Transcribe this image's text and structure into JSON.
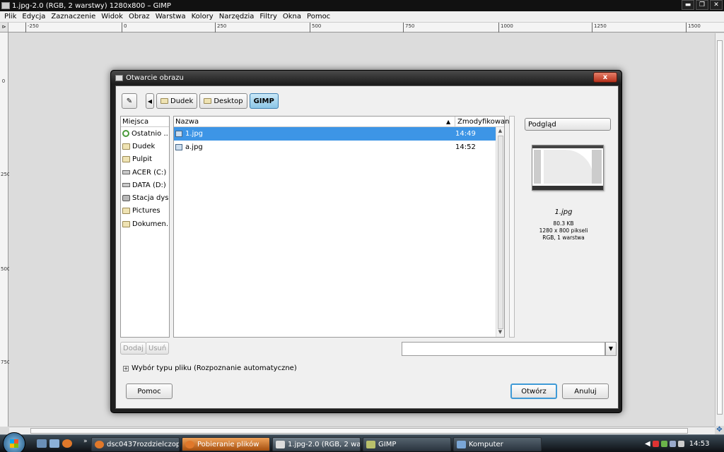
{
  "window": {
    "title": "1.jpg-2.0 (RGB, 2 warstwy) 1280x800 – GIMP",
    "controls": {
      "min": "▬",
      "max": "❐",
      "close": "✕"
    }
  },
  "menu": [
    {
      "label": "Plik"
    },
    {
      "label": "Edycja"
    },
    {
      "label": "Zaznaczenie"
    },
    {
      "label": "Widok"
    },
    {
      "label": "Obraz"
    },
    {
      "label": "Warstwa"
    },
    {
      "label": "Kolory"
    },
    {
      "label": "Narzędzia"
    },
    {
      "label": "Filtry"
    },
    {
      "label": "Okna"
    },
    {
      "label": "Pomoc"
    }
  ],
  "ruler": {
    "corner": "⊳",
    "h_ticks": [
      "-250",
      "0",
      "250",
      "500",
      "750",
      "1000",
      "1250",
      "1500"
    ],
    "v_ticks": [
      "0",
      "250",
      "500",
      "750"
    ]
  },
  "dialog": {
    "title": "Otwarcie obrazu",
    "close": "x",
    "edit_icon": "✎",
    "back_icon": "◀",
    "breadcrumb": [
      "Dudek",
      "Desktop",
      "GIMP"
    ],
    "places": {
      "header": "Miejsca",
      "items": [
        {
          "label": "Ostatnio ...",
          "icon": "recent-icon"
        },
        {
          "label": "Dudek",
          "icon": "folder-icon"
        },
        {
          "label": "Pulpit",
          "icon": "folder-icon"
        },
        {
          "label": "ACER (C:)",
          "icon": "drive-icon"
        },
        {
          "label": "DATA (D:)",
          "icon": "drive-icon"
        },
        {
          "label": "Stacja dys...",
          "icon": "network-drive-icon"
        },
        {
          "label": "Pictures",
          "icon": "folder-icon"
        },
        {
          "label": "Dokumen...",
          "icon": "folder-icon"
        }
      ],
      "add": "Dodaj",
      "remove": "Usuń"
    },
    "files": {
      "col_name": "Nazwa",
      "col_modified": "Zmodyfikowany",
      "sort_arrow": "▲",
      "scroll_up": "▲",
      "scroll_down": "▼",
      "rows": [
        {
          "name": "1.jpg",
          "time": "14:49",
          "selected": true
        },
        {
          "name": "a.jpg",
          "time": "14:52",
          "selected": false
        }
      ]
    },
    "preview": {
      "button": "Podgląd",
      "name": "1.jpg",
      "size": "80.3 KB",
      "dims": "1280 x 800 pikseli",
      "mode": "RGB, 1 warstwa"
    },
    "filename_value": "",
    "dropdown_arrow": "▼",
    "filetype": {
      "plus": "+",
      "label": "Wybór typu pliku (Rozpoznanie automatyczne)"
    },
    "buttons": {
      "help": "Pomoc",
      "open": "Otwórz",
      "cancel": "Anuluj"
    }
  },
  "taskbar": {
    "more": "»",
    "tasks": [
      {
        "label": "dsc0437rozdzielczop...",
        "style": "normal"
      },
      {
        "label": "Pobieranie plików",
        "style": "orange"
      },
      {
        "label": "1.jpg-2.0 (RGB, 2 wa...",
        "style": "active"
      },
      {
        "label": "GIMP",
        "style": "normal"
      },
      {
        "label": "Komputer",
        "style": "normal"
      }
    ],
    "tray_arrow": "◀",
    "clock": "14:53"
  },
  "navigate_icon": "✥"
}
